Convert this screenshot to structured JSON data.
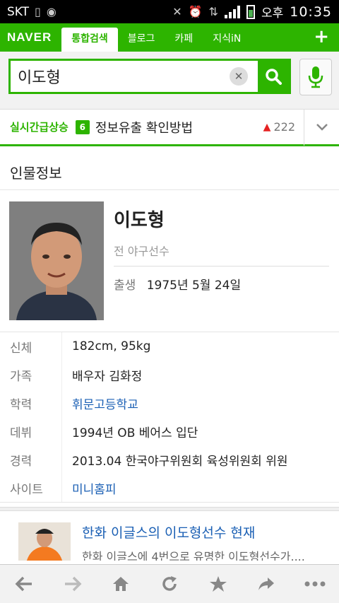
{
  "status_bar": {
    "carrier": "SKT",
    "ampm": "오후",
    "time": "10:35"
  },
  "header": {
    "logo": "NAVER",
    "tabs": [
      {
        "label": "통합검색",
        "active": true
      },
      {
        "label": "블로그",
        "active": false
      },
      {
        "label": "카페",
        "active": false
      },
      {
        "label": "지식iN",
        "active": false
      }
    ],
    "plus_label": "+"
  },
  "search": {
    "query": "이도형"
  },
  "realtime": {
    "label": "실시간급상승",
    "rank": "6",
    "keyword": "정보유출 확인방법",
    "change": "222"
  },
  "profile": {
    "section_title": "인물정보",
    "name": "이도형",
    "occupation": "전 야구선수",
    "birth_label": "출생",
    "birth_value": "1975년 5월 24일",
    "details": [
      {
        "key": "신체",
        "value": "182cm, 95kg",
        "link": false
      },
      {
        "key": "가족",
        "value": "배우자 김화정",
        "link": false
      },
      {
        "key": "학력",
        "value": "휘문고등학교",
        "link": true
      },
      {
        "key": "데뷔",
        "value": "1994년 OB 베어스 입단",
        "link": false
      },
      {
        "key": "경력",
        "value": "2013.04 한국야구위원회 육성위원회 위원",
        "link": false
      },
      {
        "key": "사이트",
        "value": "미니홈피",
        "link": true
      }
    ]
  },
  "news": {
    "title": "한화 이글스의 이도형선수 현재",
    "snippet": "한화 이글스에 4번으로 유명한 이도형선수가...."
  },
  "colors": {
    "accent": "#2db400",
    "link": "#1a5fb4",
    "up": "#e52121"
  }
}
